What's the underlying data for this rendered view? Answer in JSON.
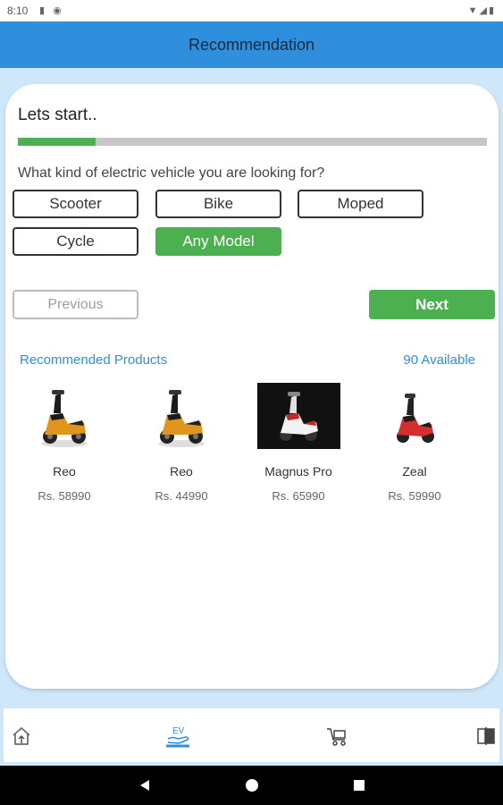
{
  "status_bar": {
    "time": "8:10",
    "left_icons": "▮ ◉",
    "right_icons": "▼◢▮"
  },
  "app_bar": {
    "title": "Recommendation"
  },
  "quiz": {
    "heading": "Lets start..",
    "progress": 0.165,
    "question": "What kind of electric vehicle you are looking for?",
    "options": [
      {
        "label": "Scooter",
        "selected": false
      },
      {
        "label": "Bike",
        "selected": false
      },
      {
        "label": "Moped",
        "selected": false
      },
      {
        "label": "Cycle",
        "selected": false
      },
      {
        "label": "Any Model",
        "selected": true
      }
    ],
    "previous_label": "Previous",
    "next_label": "Next"
  },
  "recommended": {
    "title": "Recommended Products",
    "count_text": "90 Available",
    "products": [
      {
        "name": "Reo",
        "price": "Rs. 58990",
        "image": "orange-scooter"
      },
      {
        "name": "Reo",
        "price": "Rs. 44990",
        "image": "orange-scooter"
      },
      {
        "name": "Magnus Pro",
        "price": "Rs. 65990",
        "image": "white-scooter-dark-bg"
      },
      {
        "name": "Zeal",
        "price": "Rs. 59990",
        "image": "red-scooter"
      }
    ]
  },
  "bottom_nav": {
    "items": [
      "home-icon",
      "ev-recommend-icon",
      "cart-icon",
      "compare-icon"
    ],
    "active": "ev-recommend-icon"
  },
  "colors": {
    "primary_blue": "#2f8fdd",
    "accent_green": "#4caf50",
    "background": "#cfe7fb"
  }
}
